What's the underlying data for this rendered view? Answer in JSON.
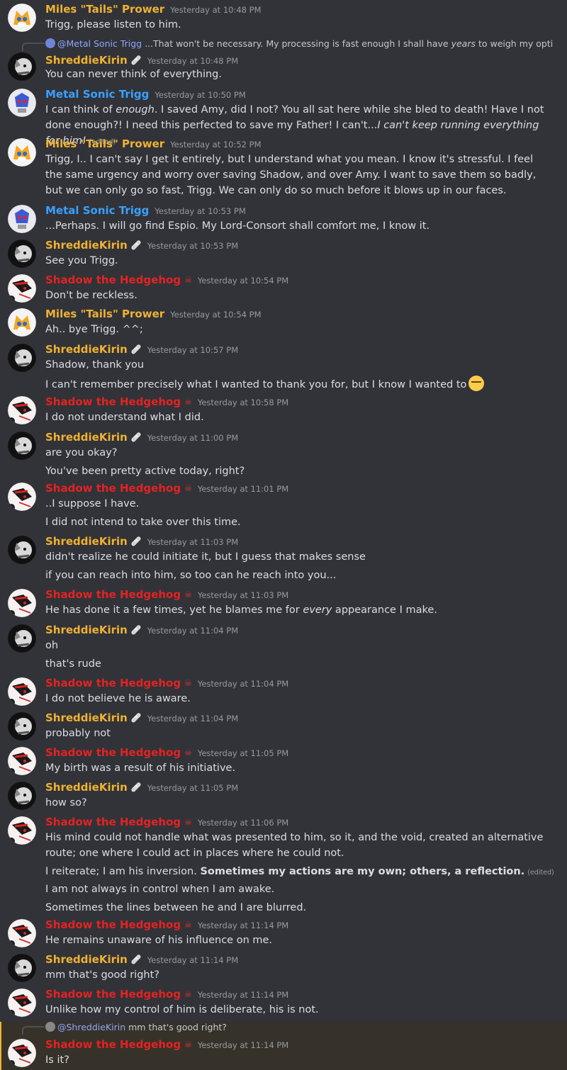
{
  "users": {
    "tails": {
      "name": "Miles \"Tails\" Prower",
      "color": "#f0b232",
      "avatar": "tails-avatar"
    },
    "shreddie": {
      "name": "ShreddieKirin",
      "color": "#f0b232",
      "badge": "🩹",
      "avatar": "shreddie-avatar"
    },
    "metal": {
      "name": "Metal Sonic Trigg",
      "color": "#3ba0ff",
      "avatar": "metal-avatar"
    },
    "shadow": {
      "name": "Shadow the Hedgehog",
      "color": "#e52222",
      "badge": "☠",
      "avatar": "shadow-avatar"
    }
  },
  "messages": [
    {
      "user": "tails",
      "time": "Yesterday at 10:48 PM",
      "lines": [
        "Trigg, please listen to him."
      ]
    },
    {
      "reply_to": {
        "mention": "@Metal Sonic Trigg",
        "text_before": " ...That won't be necessary. My processing is fast enough I shall have ",
        "text_em": "years",
        "text_after": " to weigh my options i..."
      },
      "user": "shreddie",
      "time": "Yesterday at 10:48 PM",
      "lines": [
        "You can never think of everything."
      ]
    },
    {
      "user": "metal",
      "time": "Yesterday at 10:50 PM",
      "lines": [
        "I can think of enough. I saved Amy, did I not? You all sat here while she bled to death! Have I not done enough?! I need this perfected to save my Father! I can't...I can't keep running everything for him!"
      ],
      "edited": "(edited)"
    },
    {
      "user": "tails",
      "time": "Yesterday at 10:52 PM",
      "lines": [
        "Trigg, I.. I can't say I get it entirely, but I understand what you mean. I know it's stressful. I feel the same urgency and worry over saving Shadow, and over Amy. I want to save them so badly, but we can only go so fast, Trigg. We can only do so much before it blows up in our faces."
      ]
    },
    {
      "user": "metal",
      "time": "Yesterday at 10:53 PM",
      "lines": [
        "...Perhaps. I will go find Espio. My Lord-Consort shall comfort me, I know it."
      ]
    },
    {
      "user": "shreddie",
      "time": "Yesterday at 10:53 PM",
      "lines": [
        "See you Trigg."
      ]
    },
    {
      "user": "shadow",
      "time": "Yesterday at 10:54 PM",
      "lines": [
        "Don't be reckless."
      ]
    },
    {
      "user": "tails",
      "time": "Yesterday at 10:54 PM",
      "lines": [
        "Ah.. bye Trigg. ^^;"
      ]
    },
    {
      "user": "shreddie",
      "time": "Yesterday at 10:57 PM",
      "lines": [
        "Shadow, thank you",
        "I can't remember precisely what I wanted to thank you for, but I know I wanted to"
      ]
    },
    {
      "user": "shadow",
      "time": "Yesterday at 10:58 PM",
      "lines": [
        "I do not understand what I did."
      ]
    },
    {
      "user": "shreddie",
      "time": "Yesterday at 11:00 PM",
      "lines": [
        "are you okay?",
        "You've been pretty active today, right?"
      ]
    },
    {
      "user": "shadow",
      "time": "Yesterday at 11:01 PM",
      "lines": [
        "..I suppose I have.",
        "I did not intend to take over this time."
      ]
    },
    {
      "user": "shreddie",
      "time": "Yesterday at 11:03 PM",
      "lines": [
        "didn't realize he could initiate it, but I guess that makes sense",
        "if you can reach into him, so too can he reach into you..."
      ]
    },
    {
      "user": "shadow",
      "time": "Yesterday at 11:03 PM",
      "lines": [
        "He has done it a few times, yet he blames me for every appearance I make."
      ]
    },
    {
      "user": "shreddie",
      "time": "Yesterday at 11:04 PM",
      "lines": [
        "oh",
        "that's rude"
      ]
    },
    {
      "user": "shadow",
      "time": "Yesterday at 11:04 PM",
      "lines": [
        "I do not believe he is aware."
      ]
    },
    {
      "user": "shreddie",
      "time": "Yesterday at 11:04 PM",
      "lines": [
        "probably not"
      ]
    },
    {
      "user": "shadow",
      "time": "Yesterday at 11:05 PM",
      "lines": [
        "My birth was a result of his initiative."
      ]
    },
    {
      "user": "shreddie",
      "time": "Yesterday at 11:05 PM",
      "lines": [
        "how so?"
      ]
    },
    {
      "user": "shadow",
      "time": "Yesterday at 11:06 PM",
      "lines": [
        "His mind could not handle what was presented to him, so it, and the void, created an alternative route; one where I could act in places where he could not.",
        "I reiterate; I am his inversion. Sometimes my actions are my own; others, a reflection.",
        "I am not always in control when I am awake.",
        "Sometimes the lines between he and I are blurred."
      ],
      "edited": "(edited)"
    },
    {
      "user": "shadow",
      "time": "Yesterday at 11:14 PM",
      "lines": [
        "He remains unaware of his influence on me."
      ]
    },
    {
      "user": "shreddie",
      "time": "Yesterday at 11:14 PM",
      "lines": [
        "mm that's good right?"
      ]
    },
    {
      "user": "shadow",
      "time": "Yesterday at 11:14 PM",
      "lines": [
        "Unlike how my control of him is deliberate, his is not."
      ]
    },
    {
      "reply_to": {
        "mention": "@ShreddieKirin",
        "text": " mm that's good right?"
      },
      "user": "shadow",
      "time": "Yesterday at 11:14 PM",
      "lines": [
        "Is it?"
      ],
      "highlighted": true
    }
  ]
}
